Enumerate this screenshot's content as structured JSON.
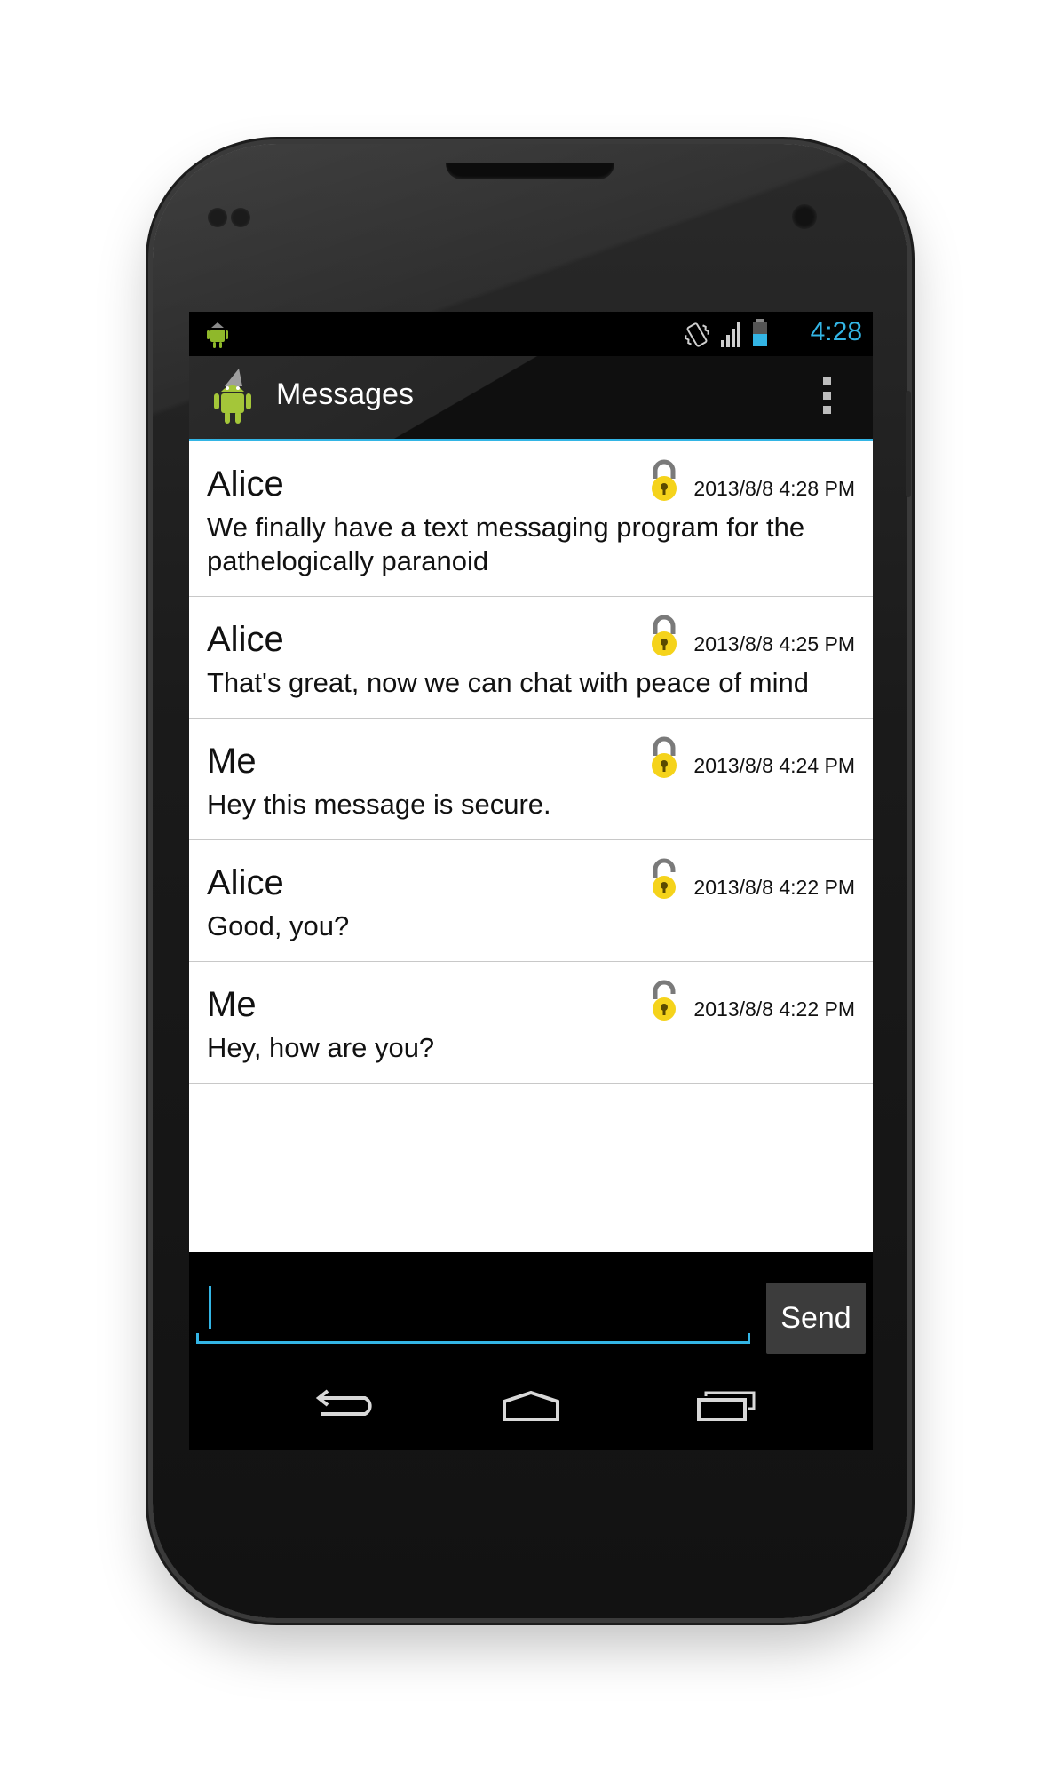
{
  "status_bar": {
    "time": "4:28",
    "icons": [
      "notification-android-icon",
      "vibrate-icon",
      "signal-icon",
      "battery-icon"
    ]
  },
  "action_bar": {
    "title": "Messages",
    "app_icon": "android-icon",
    "menu_icon": "overflow-menu-icon"
  },
  "messages": [
    {
      "sender": "Alice",
      "timestamp": "2013/8/8 4:28 PM",
      "text": "We finally have a text messaging program for the pathelogically paranoid",
      "lock": "padlock-icon"
    },
    {
      "sender": "Alice",
      "timestamp": "2013/8/8 4:25 PM",
      "text": "That's great, now we can chat with peace of mind",
      "lock": "padlock-icon"
    },
    {
      "sender": "Me",
      "timestamp": "2013/8/8 4:24 PM",
      "text": "Hey this message is secure.",
      "lock": "padlock-icon"
    },
    {
      "sender": "Alice",
      "timestamp": "2013/8/8 4:22 PM",
      "text": "Good, you?",
      "lock": "padlock-icon"
    },
    {
      "sender": "Me",
      "timestamp": "2013/8/8 4:22 PM",
      "text": "Hey, how are you?",
      "lock": "padlock-icon"
    }
  ],
  "composer": {
    "input_value": "",
    "send_label": "Send"
  },
  "nav_bar": {
    "buttons": [
      "back-icon",
      "home-icon",
      "recent-apps-icon"
    ]
  },
  "colors": {
    "accent": "#33b5e5",
    "lock_body": "#f5d31b",
    "lock_shackle": "#7a7a7a"
  }
}
